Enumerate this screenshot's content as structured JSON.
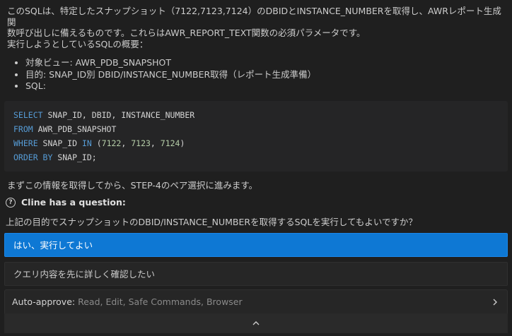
{
  "message": {
    "line1": "このSQLは、特定したスナップショット（7122,7123,7124）のDBIDとINSTANCE_NUMBERを取得し、AWRレポート生成関",
    "line2": "数呼び出しに備えるものです。これらはAWR_REPORT_TEXT関数の必須パラメータです。",
    "line3": "実行しようとしているSQLの概要：",
    "bullets": [
      "対象ビュー: AWR_PDB_SNAPSHOT",
      "目的: SNAP_ID別 DBID/INSTANCE_NUMBER取得（レポート生成準備）",
      "SQL:"
    ],
    "code": {
      "l1_kw": "SELECT",
      "l1_rest": " SNAP_ID, DBID, INSTANCE_NUMBER",
      "l2_kw": "FROM",
      "l2_rest": " AWR_PDB_SNAPSHOT",
      "l3_kw": "WHERE",
      "l3_mid": " SNAP_ID ",
      "l3_kw2": "IN",
      "l3_open": " (",
      "l3_n1": "7122",
      "l3_sep1": ", ",
      "l3_n2": "7123",
      "l3_sep2": ", ",
      "l3_n3": "7124",
      "l3_close": ")",
      "l4_kw": "ORDER BY",
      "l4_rest": " SNAP_ID;"
    },
    "after": "まずこの情報を取得してから、STEP-4のペア選択に進みます。"
  },
  "question": {
    "icon": "question-circle-icon",
    "icon_glyph": "?",
    "header": "Cline has a question:",
    "text": "上記の目的でスナップショットのDBID/INSTANCE_NUMBERを取得するSQLを実行してもよいですか？",
    "options": [
      "はい、実行してよい",
      "クエリ内容を先に詳しく確認したい"
    ]
  },
  "auto_approve": {
    "label": "Auto-approve:",
    "value": "Read, Edit, Safe Commands, Browser",
    "icon": "chevron-right-icon"
  },
  "collapse": {
    "icon": "chevron-up-icon"
  },
  "colors": {
    "background": "#1f1f1f",
    "primary_button": "#0e78d4",
    "keyword": "#569cd6",
    "number": "#b5cea8"
  }
}
